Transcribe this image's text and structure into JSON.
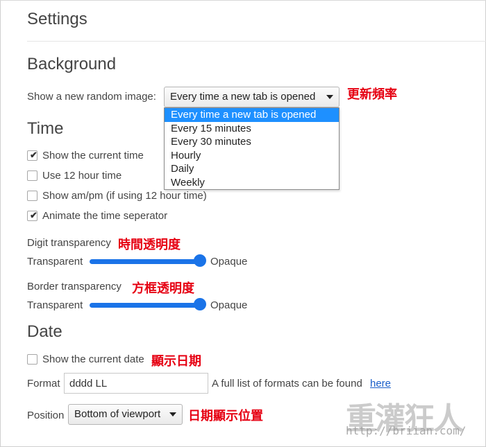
{
  "page": {
    "title": "Settings"
  },
  "background": {
    "title": "Background",
    "image_label": "Show a new random image:",
    "image_select_value": "Every time a new tab is opened",
    "image_options": [
      "Every time a new tab is opened",
      "Every 15 minutes",
      "Every 30 minutes",
      "Hourly",
      "Daily",
      "Weekly"
    ],
    "annotation": "更新頻率"
  },
  "time": {
    "title": "Time",
    "options": [
      {
        "label": "Show the current time",
        "checked": true
      },
      {
        "label": "Use 12 hour time",
        "checked": false
      },
      {
        "label": "Show am/pm (if using 12 hour time)",
        "checked": false
      },
      {
        "label": "Animate the time seperator",
        "checked": true
      }
    ],
    "digit_transparency": {
      "label": "Digit transparency",
      "annotation": "時間透明度",
      "min_label": "Transparent",
      "max_label": "Opaque",
      "value": 1.0
    },
    "border_transparency": {
      "label": "Border transparency",
      "annotation": "方框透明度",
      "min_label": "Transparent",
      "max_label": "Opaque",
      "value": 1.0
    }
  },
  "date": {
    "title": "Date",
    "show_label": "Show the current date",
    "show_checked": false,
    "show_annotation": "顯示日期",
    "format_label": "Format",
    "format_value": "dddd LL",
    "format_help": "A full list of formats can be found",
    "format_link": "here",
    "position_label": "Position",
    "position_value": "Bottom of viewport",
    "position_annotation": "日期顯示位置"
  },
  "watermark": {
    "brand": "重灌狂人",
    "url": "http://briian.com/"
  },
  "colors": {
    "accent": "#1a73e8",
    "annotation": "#e60012",
    "selected_option": "#1e90ff"
  }
}
